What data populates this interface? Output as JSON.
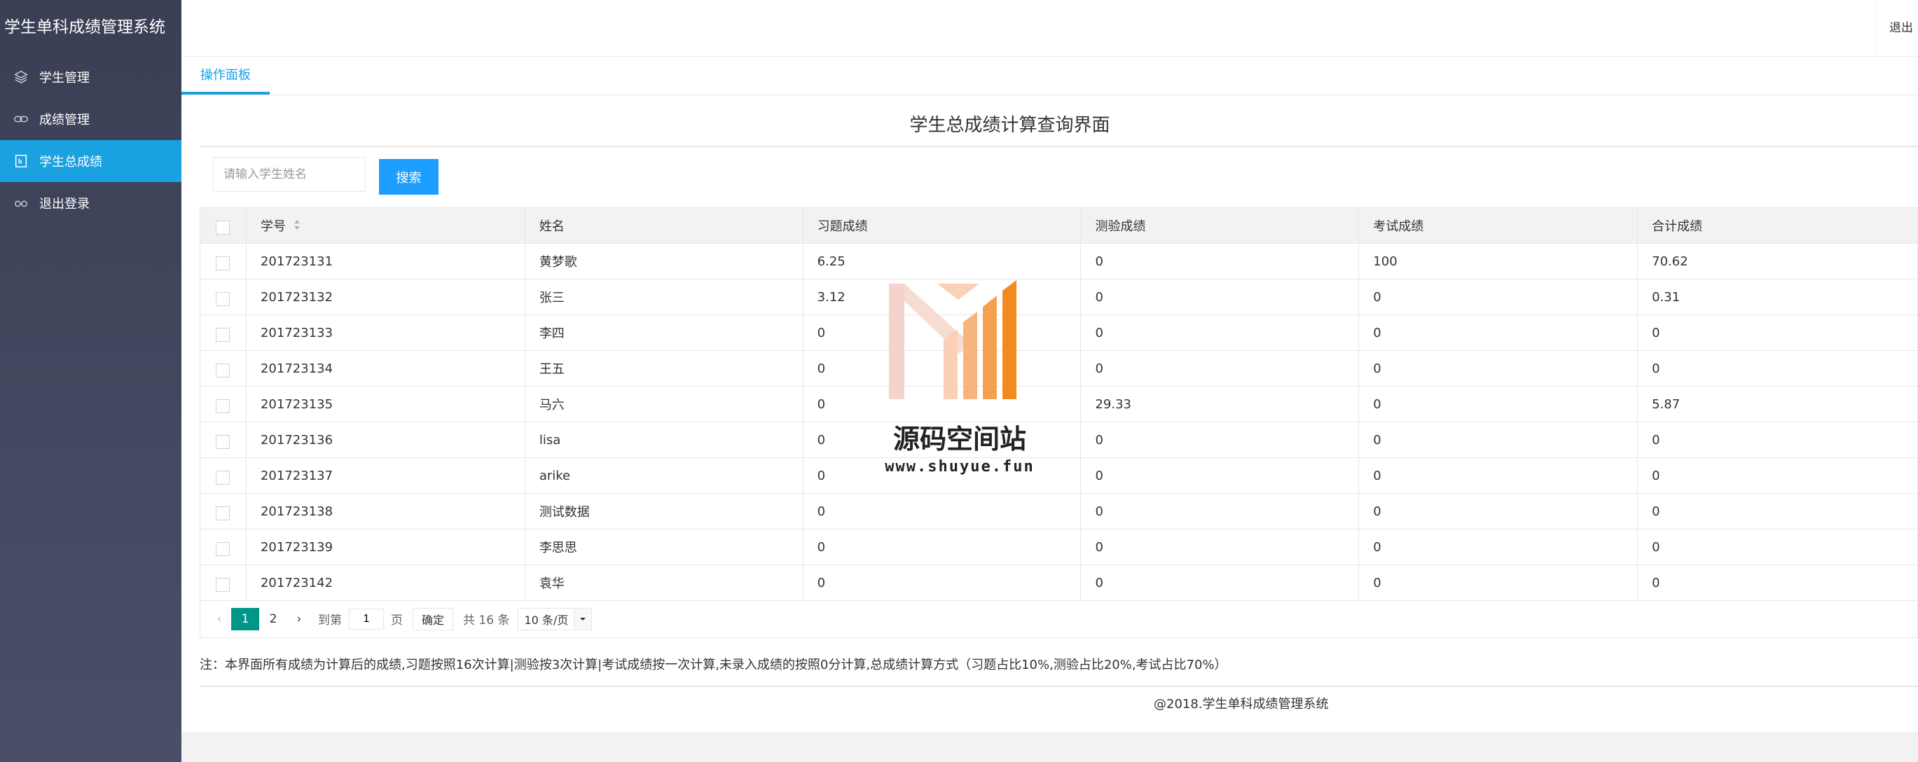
{
  "app": {
    "title": "学生单科成绩管理系统"
  },
  "sidebar": {
    "items": [
      {
        "label": "学生管理",
        "icon": "layers-icon",
        "active": false
      },
      {
        "label": "成绩管理",
        "icon": "link-icon",
        "active": false
      },
      {
        "label": "学生总成绩",
        "icon": "report-icon",
        "active": true
      },
      {
        "label": "退出登录",
        "icon": "glasses-icon",
        "active": false
      }
    ]
  },
  "header": {
    "logout": "退出"
  },
  "tabs": [
    {
      "label": "操作面板",
      "active": true
    }
  ],
  "main": {
    "heading": "学生总成绩计算查询界面",
    "search": {
      "placeholder": "请输入学生姓名",
      "value": "",
      "button": "搜索"
    }
  },
  "table": {
    "columns": [
      "学号",
      "姓名",
      "习题成绩",
      "测验成绩",
      "考试成绩",
      "合计成绩"
    ],
    "rows": [
      [
        "201723131",
        "黄梦歌",
        "6.25",
        "0",
        "100",
        "70.62"
      ],
      [
        "201723132",
        "张三",
        "3.12",
        "0",
        "0",
        "0.31"
      ],
      [
        "201723133",
        "李四",
        "0",
        "0",
        "0",
        "0"
      ],
      [
        "201723134",
        "王五",
        "0",
        "0",
        "0",
        "0"
      ],
      [
        "201723135",
        "马六",
        "0",
        "29.33",
        "0",
        "5.87"
      ],
      [
        "201723136",
        "lisa",
        "0",
        "0",
        "0",
        "0"
      ],
      [
        "201723137",
        "arike",
        "0",
        "0",
        "0",
        "0"
      ],
      [
        "201723138",
        "测试数据",
        "0",
        "0",
        "0",
        "0"
      ],
      [
        "201723139",
        "李思思",
        "0",
        "0",
        "0",
        "0"
      ],
      [
        "201723142",
        "袁华",
        "0",
        "0",
        "0",
        "0"
      ]
    ]
  },
  "pager": {
    "prev": "‹",
    "pages": [
      "1",
      "2"
    ],
    "current": "1",
    "next": "›",
    "goto_label": "到第",
    "goto_value": "1",
    "page_unit": "页",
    "confirm": "确定",
    "total": "共 16 条",
    "limit": "10 条/页"
  },
  "note": "注：本界面所有成绩为计算后的成绩,习题按照16次计算|测验按3次计算|考试成绩按一次计算,未录入成绩的按照0分计算,总成绩计算方式（习题占比10%,测验占比20%,考试占比70%）",
  "footer": {
    "copyright": "@2018.学生单科成绩管理系统"
  },
  "watermark": {
    "name": "源码空间站",
    "url": "www.shuyue.fun"
  },
  "colors": {
    "sidebar": "#3a3f54",
    "active": "#1aa1e0",
    "button": "#1e9fff",
    "pager_current": "#009688"
  }
}
